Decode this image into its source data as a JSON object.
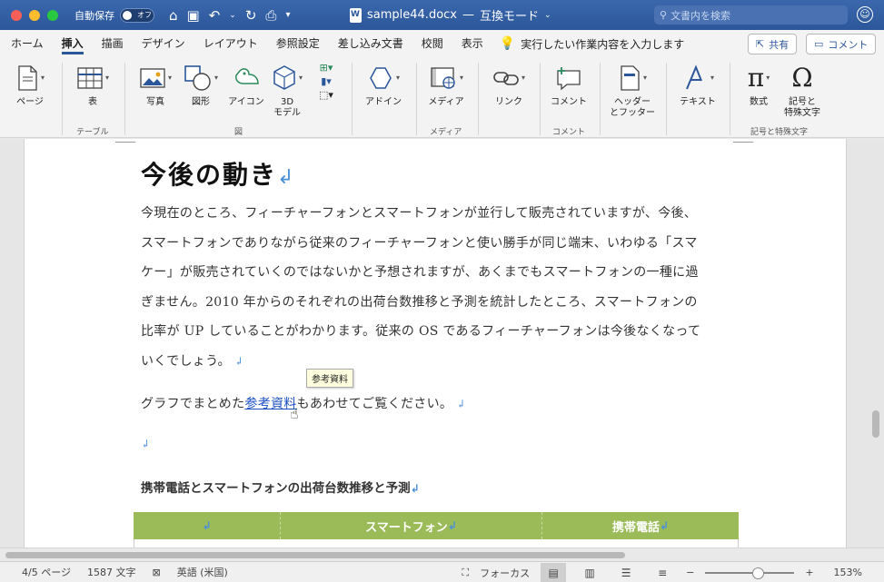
{
  "titlebar": {
    "autosave_label": "自動保存",
    "autosave_state": "オフ",
    "document_name": "sample44.docx",
    "mode": "互換モード",
    "search_placeholder": "文書内を検索"
  },
  "tabs": [
    {
      "label": "ホーム"
    },
    {
      "label": "挿入",
      "active": true
    },
    {
      "label": "描画"
    },
    {
      "label": "デザイン"
    },
    {
      "label": "レイアウト"
    },
    {
      "label": "参照設定"
    },
    {
      "label": "差し込み文書"
    },
    {
      "label": "校閲"
    },
    {
      "label": "表示"
    }
  ],
  "tellme": "実行したい作業内容を入力します",
  "share_label": "共有",
  "comment_label": "コメント",
  "ribbon": {
    "page": "ページ",
    "table": "表",
    "group_table": "テーブル",
    "picture": "写真",
    "shapes": "図形",
    "icons": "アイコン",
    "model3d_line1": "3D",
    "model3d_line2": "モデル",
    "group_illustrations": "図",
    "addins": "アドイン",
    "media": "メディア",
    "group_media": "メディア",
    "link": "リンク",
    "comment": "コメント",
    "group_comment": "コメント",
    "header_footer_line1": "ヘッダー",
    "header_footer_line2": "とフッター",
    "text": "テキスト",
    "equation": "数式",
    "symbol_line1": "記号と",
    "symbol_line2": "特殊文字",
    "group_symbols": "記号と特殊文字"
  },
  "document": {
    "heading": "今後の動き",
    "paragraph1_lines": [
      "今現在のところ、フィーチャーフォンとスマートフォンが並行して販売されていますが、今後、",
      "スマートフォンでありながら従来のフィーチャーフォンと使い勝手が同じ端末、いわゆる「スマ",
      "ケー」が販売されていくのではないかと予想されますが、あくまでもスマートフォンの一種に過",
      "ぎません。2010 年からのそれぞれの出荷台数推移と予測を統計したところ、スマートフォンの",
      "比率が UP していることがわかります。従来の OS であるフィーチャーフォンは今後なくなって",
      "いくでしょう。"
    ],
    "paragraph2_before": "グラフでまとめた",
    "paragraph2_link": "参考資料",
    "paragraph2_after": "もあわせてご覧ください。",
    "tooltip": "参考資料",
    "subheading": "携帯電話とスマートフォンの出荷台数推移と予測",
    "table_headers": [
      "",
      "スマートフォン",
      "携帯電話"
    ]
  },
  "status": {
    "page": "4/5 ページ",
    "words": "1587 文字",
    "language": "英語 (米国)",
    "focus": "フォーカス",
    "zoom": "153%"
  }
}
